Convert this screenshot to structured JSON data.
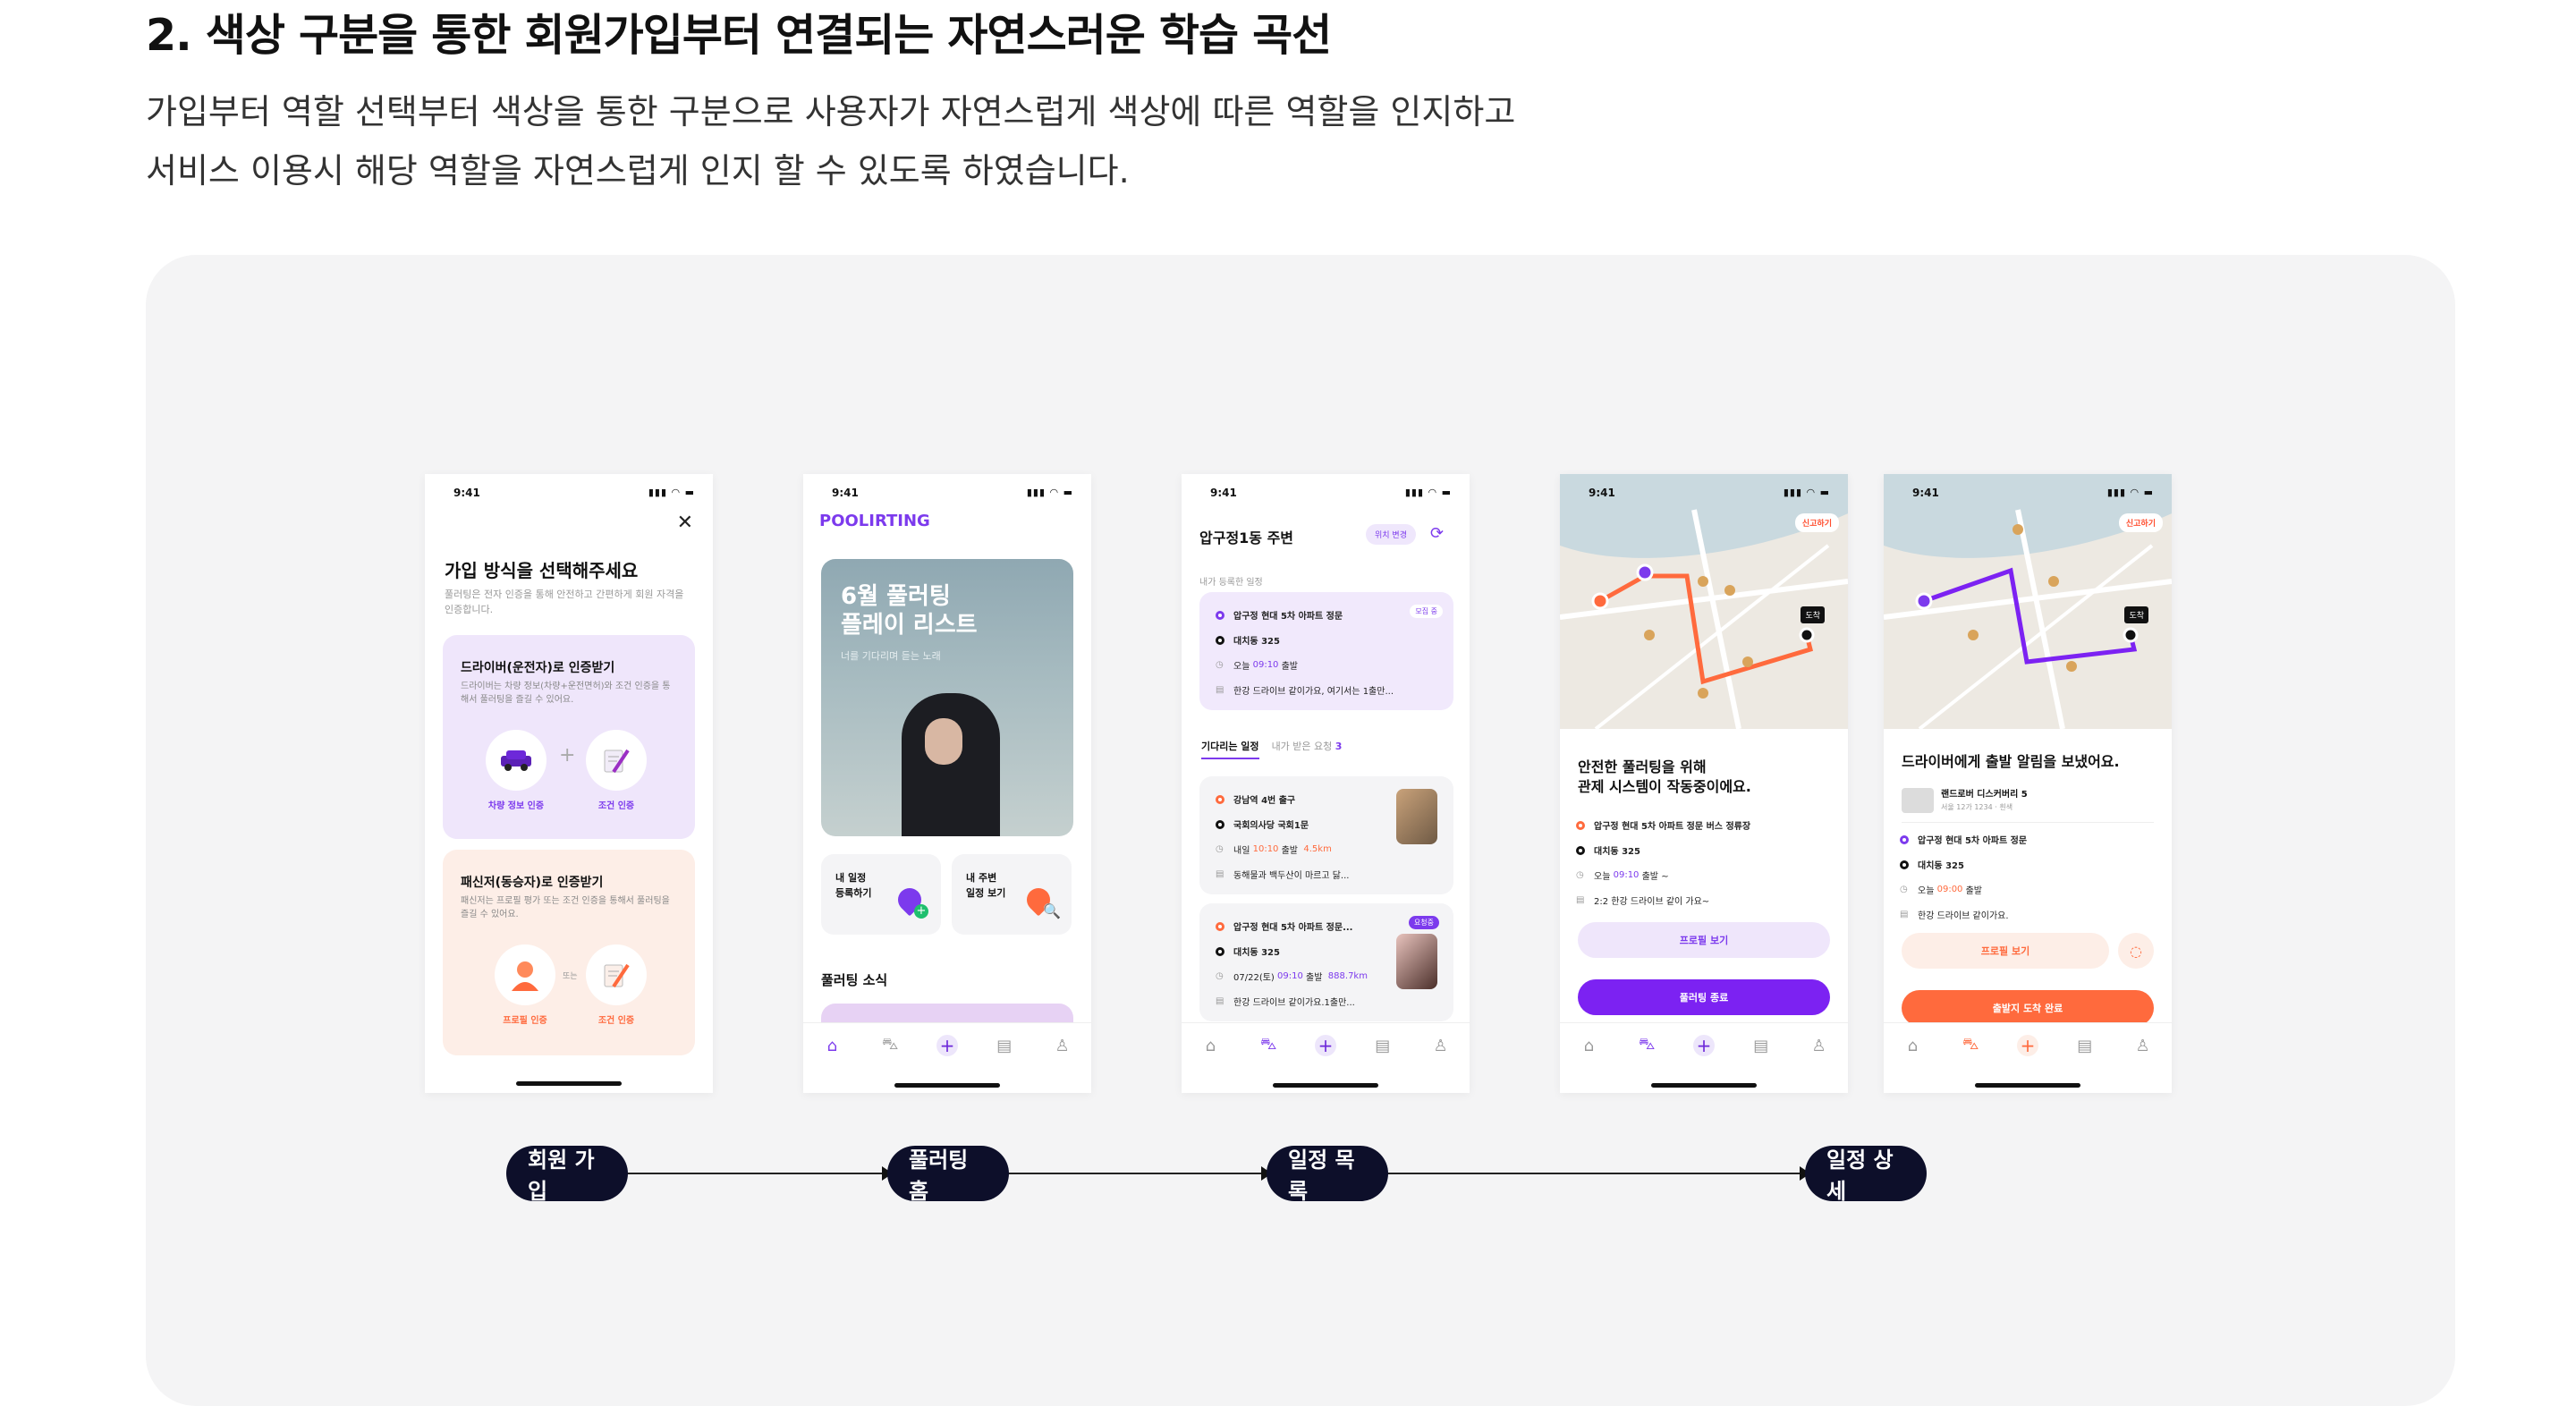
{
  "header": {
    "title": "2. 색상 구분을 통한 회원가입부터 연결되는 자연스러운 학습 곡선",
    "desc_line1": "가입부터 역할 선택부터 색상을 통한 구분으로 사용자가 자연스럽게 색상에 따른 역할을 인지하고",
    "desc_line2": "서비스 이용시 해당 역할을 자연스럽게 인지 할 수 있도록 하였습니다."
  },
  "status_time": "9:41",
  "signup": {
    "title": "가입 방식을 선택해주세요",
    "subtitle": "풀러팅은 전자 인증을 통해 안전하고 간편하게 회원 자격을 인증합니다.",
    "driver_card_title": "드라이버(운전자)로 인증받기",
    "driver_card_desc": "드라이버는 차량 정보(차량+운전면허)와 조건 인증을 통해서 풀러팅을 즐길 수 있어요.",
    "vehicle_label": "차량 정보 인증",
    "condition_label": "조건 인증",
    "passenger_card_title": "패신저(동승자)로 인증받기",
    "passenger_card_desc": "패신저는 프로필 평가 또는 조건 인증을 통해서 풀러팅을 즐길 수 있어요.",
    "profile_label": "프로필 인증",
    "or_text": "또는",
    "condition_label2": "조건 인증"
  },
  "home": {
    "brand": "POOLIRTING",
    "hero_title_1": "6월 풀러팅",
    "hero_title_2": "플레이 리스트",
    "hero_sub": "너를 기다리며 듣는 노래",
    "tile1_l1": "내 일정",
    "tile1_l2": "등록하기",
    "tile2_l1": "내 주변",
    "tile2_l2": "일정 보기",
    "news": "풀러팅 소식"
  },
  "schedule": {
    "header": "압구정1동 주변",
    "change_location": "위치 변경",
    "registered_label": "내가 등록한 일정",
    "badge_waiting": "모집 중",
    "my_from": "압구정 현대 5차 아파트 정문",
    "my_to": "대치동 325",
    "my_time_prefix": "오늘",
    "my_time": "09:10",
    "my_time_suffix": "출발",
    "my_note": "한강 드라이브 같이가요, 여기서는 1출만...",
    "tab_waiting": "기다리는 일정",
    "tab_received": "내가 받은 요청",
    "tab_received_count": "3",
    "i1_from": "강남역 4번 출구",
    "i1_to": "국회의사당 국회1문",
    "i1_time_prefix": "내일",
    "i1_time": "10:10",
    "i1_time_suffix": "출발",
    "i1_dist": "4.5km",
    "i1_note": "동해물과 백두산이 마르고 닳...",
    "i2_badge": "요청중",
    "i2_from": "압구정 현대 5차 아파트 정문...",
    "i2_to": "대치동 325",
    "i2_time_prefix": "07/22(토)",
    "i2_time": "09:10",
    "i2_time_suffix": "출발",
    "i2_dist": "888.7km",
    "i2_note": "한강 드라이브 같이가요.1출만..."
  },
  "detail_a": {
    "report": "신고하기",
    "arrive": "도착",
    "sheet_title_1": "안전한 풀러팅을 위해",
    "sheet_title_2": "관제 시스템이 작동중이에요.",
    "from": "압구정 현대 5차 아파트 정문 버스 정류장",
    "to": "대치동 325",
    "time_prefix": "오늘",
    "time": "09:10",
    "time_suffix": "출발 ~",
    "note": "2:2 한강 드라이브 같이 가요~",
    "profile_btn": "프로필 보기",
    "end_btn": "풀러팅 종료"
  },
  "detail_b": {
    "report": "신고하기",
    "arrive": "도착",
    "sheet_title": "드라이버에게 출발 알림을 보냈어요.",
    "car_name": "랜드로버 디스커버리 5",
    "car_info": "서울 12가 1234 · 흰색",
    "from": "압구정 현대 5차 아파트 정문",
    "to": "대치동 325",
    "time_prefix": "오늘",
    "time": "09:00",
    "time_suffix": "출발",
    "note": "한강 드라이브 같이가요.",
    "profile_btn": "프로필 보기",
    "done_btn": "출발지 도착 완료"
  },
  "flow": {
    "step1": "회원 가입",
    "step2": "풀러팅 홈",
    "step3": "일정 목록",
    "step4": "일정 상세"
  },
  "colors": {
    "driver_purple": "#7c3aed",
    "passenger_orange": "#ff6a3d",
    "driver_card_bg": "#efe6fb",
    "passenger_card_bg": "#fdeee7",
    "flow_pill": "#0d0f2a"
  }
}
